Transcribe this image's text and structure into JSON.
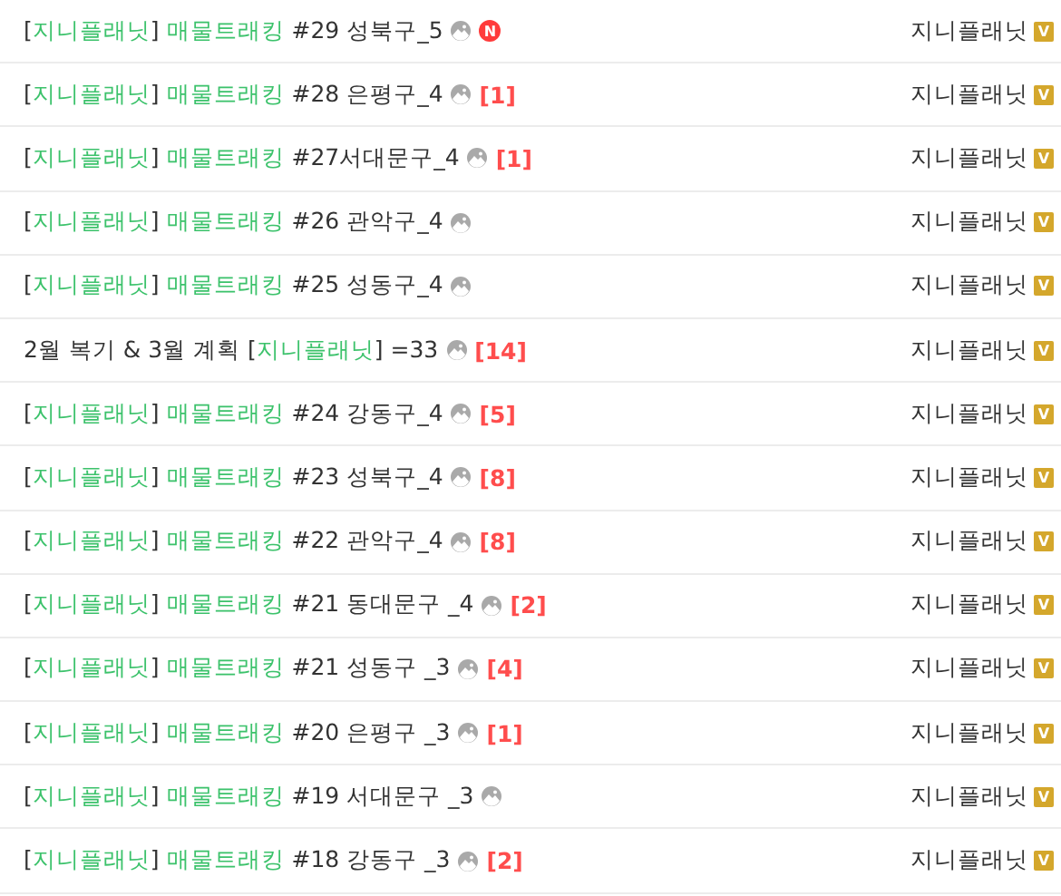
{
  "posts": [
    {
      "title": [
        {
          "text": "[",
          "green": false
        },
        {
          "text": "지니플래닛",
          "green": true
        },
        {
          "text": "] ",
          "green": false
        },
        {
          "text": "매물트래킹",
          "green": true
        },
        {
          "text": " #29 성북구_5",
          "green": false
        }
      ],
      "new_badge": "N",
      "author": "지니플래닛",
      "author_badge": "V"
    },
    {
      "title": [
        {
          "text": "[",
          "green": false
        },
        {
          "text": "지니플래닛",
          "green": true
        },
        {
          "text": "] ",
          "green": false
        },
        {
          "text": "매물트래킹",
          "green": true
        },
        {
          "text": " #28 은평구_4",
          "green": false
        }
      ],
      "comments": "[1]",
      "author": "지니플래닛",
      "author_badge": "V"
    },
    {
      "title": [
        {
          "text": "[",
          "green": false
        },
        {
          "text": "지니플래닛",
          "green": true
        },
        {
          "text": "] ",
          "green": false
        },
        {
          "text": "매물트래킹",
          "green": true
        },
        {
          "text": " #27서대문구_4",
          "green": false
        }
      ],
      "comments": "[1]",
      "author": "지니플래닛",
      "author_badge": "V"
    },
    {
      "title": [
        {
          "text": "[",
          "green": false
        },
        {
          "text": "지니플래닛",
          "green": true
        },
        {
          "text": "] ",
          "green": false
        },
        {
          "text": "매물트래킹",
          "green": true
        },
        {
          "text": " #26 관악구_4",
          "green": false
        }
      ],
      "author": "지니플래닛",
      "author_badge": "V"
    },
    {
      "title": [
        {
          "text": "[",
          "green": false
        },
        {
          "text": "지니플래닛",
          "green": true
        },
        {
          "text": "] ",
          "green": false
        },
        {
          "text": "매물트래킹",
          "green": true
        },
        {
          "text": " #25 성동구_4",
          "green": false
        }
      ],
      "author": "지니플래닛",
      "author_badge": "V"
    },
    {
      "title": [
        {
          "text": "2월 복기 & 3월 계획 [",
          "green": false
        },
        {
          "text": "지니플래닛",
          "green": true
        },
        {
          "text": "] =33",
          "green": false
        }
      ],
      "comments": "[14]",
      "author": "지니플래닛",
      "author_badge": "V"
    },
    {
      "title": [
        {
          "text": "[",
          "green": false
        },
        {
          "text": "지니플래닛",
          "green": true
        },
        {
          "text": "] ",
          "green": false
        },
        {
          "text": "매물트래킹",
          "green": true
        },
        {
          "text": " #24 강동구_4",
          "green": false
        }
      ],
      "comments": "[5]",
      "author": "지니플래닛",
      "author_badge": "V"
    },
    {
      "title": [
        {
          "text": "[",
          "green": false
        },
        {
          "text": "지니플래닛",
          "green": true
        },
        {
          "text": "] ",
          "green": false
        },
        {
          "text": "매물트래킹",
          "green": true
        },
        {
          "text": " #23 성북구_4",
          "green": false
        }
      ],
      "comments": "[8]",
      "author": "지니플래닛",
      "author_badge": "V"
    },
    {
      "title": [
        {
          "text": "[",
          "green": false
        },
        {
          "text": "지니플래닛",
          "green": true
        },
        {
          "text": "] ",
          "green": false
        },
        {
          "text": "매물트래킹",
          "green": true
        },
        {
          "text": " #22 관악구_4",
          "green": false
        }
      ],
      "comments": "[8]",
      "author": "지니플래닛",
      "author_badge": "V"
    },
    {
      "title": [
        {
          "text": "[",
          "green": false
        },
        {
          "text": "지니플래닛",
          "green": true
        },
        {
          "text": "] ",
          "green": false
        },
        {
          "text": "매물트래킹",
          "green": true
        },
        {
          "text": " #21 동대문구 _4",
          "green": false
        }
      ],
      "comments": "[2]",
      "author": "지니플래닛",
      "author_badge": "V"
    },
    {
      "title": [
        {
          "text": "[",
          "green": false
        },
        {
          "text": "지니플래닛",
          "green": true
        },
        {
          "text": "] ",
          "green": false
        },
        {
          "text": "매물트래킹",
          "green": true
        },
        {
          "text": " #21 성동구 _3",
          "green": false
        }
      ],
      "comments": "[4]",
      "author": "지니플래닛",
      "author_badge": "V"
    },
    {
      "title": [
        {
          "text": "[",
          "green": false
        },
        {
          "text": "지니플래닛",
          "green": true
        },
        {
          "text": "] ",
          "green": false
        },
        {
          "text": "매물트래킹",
          "green": true
        },
        {
          "text": " #20 은평구 _3",
          "green": false
        }
      ],
      "comments": "[1]",
      "author": "지니플래닛",
      "author_badge": "V"
    },
    {
      "title": [
        {
          "text": "[",
          "green": false
        },
        {
          "text": "지니플래닛",
          "green": true
        },
        {
          "text": "] ",
          "green": false
        },
        {
          "text": "매물트래킹",
          "green": true
        },
        {
          "text": " #19 서대문구 _3",
          "green": false
        }
      ],
      "author": "지니플래닛",
      "author_badge": "V"
    },
    {
      "title": [
        {
          "text": "[",
          "green": false
        },
        {
          "text": "지니플래닛",
          "green": true
        },
        {
          "text": "] ",
          "green": false
        },
        {
          "text": "매물트래킹",
          "green": true
        },
        {
          "text": " #18 강동구 _3",
          "green": false
        }
      ],
      "comments": "[2]",
      "author": "지니플래닛",
      "author_badge": "V"
    }
  ]
}
